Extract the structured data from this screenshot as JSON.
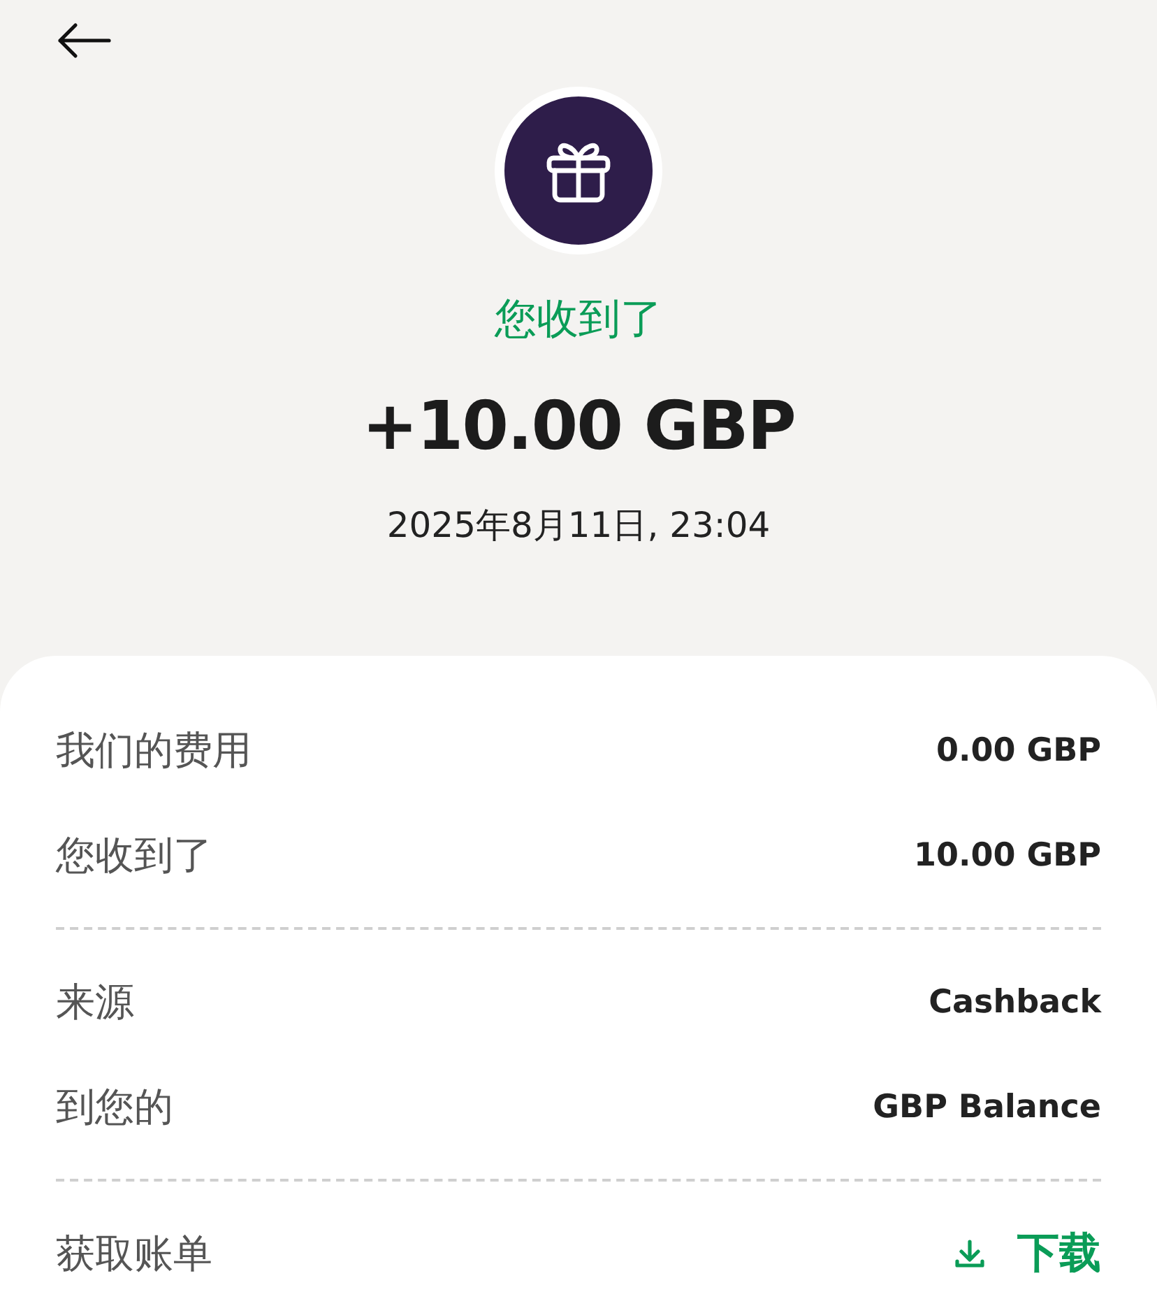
{
  "header": {
    "status": "您收到了",
    "amount": "+10.00 GBP",
    "datetime": "2025年8月11日, 23:04"
  },
  "groups": [
    {
      "rows": [
        {
          "kind": "text",
          "label": "我们的费用",
          "value": "0.00 GBP"
        },
        {
          "kind": "text",
          "label": "您收到了",
          "value": "10.00 GBP"
        }
      ]
    },
    {
      "rows": [
        {
          "kind": "text",
          "label": "来源",
          "value": "Cashback"
        },
        {
          "kind": "text",
          "label": "到您的",
          "value": "GBP Balance"
        }
      ]
    },
    {
      "rows": [
        {
          "kind": "download",
          "label": "获取账单",
          "value": "下载"
        }
      ]
    }
  ]
}
